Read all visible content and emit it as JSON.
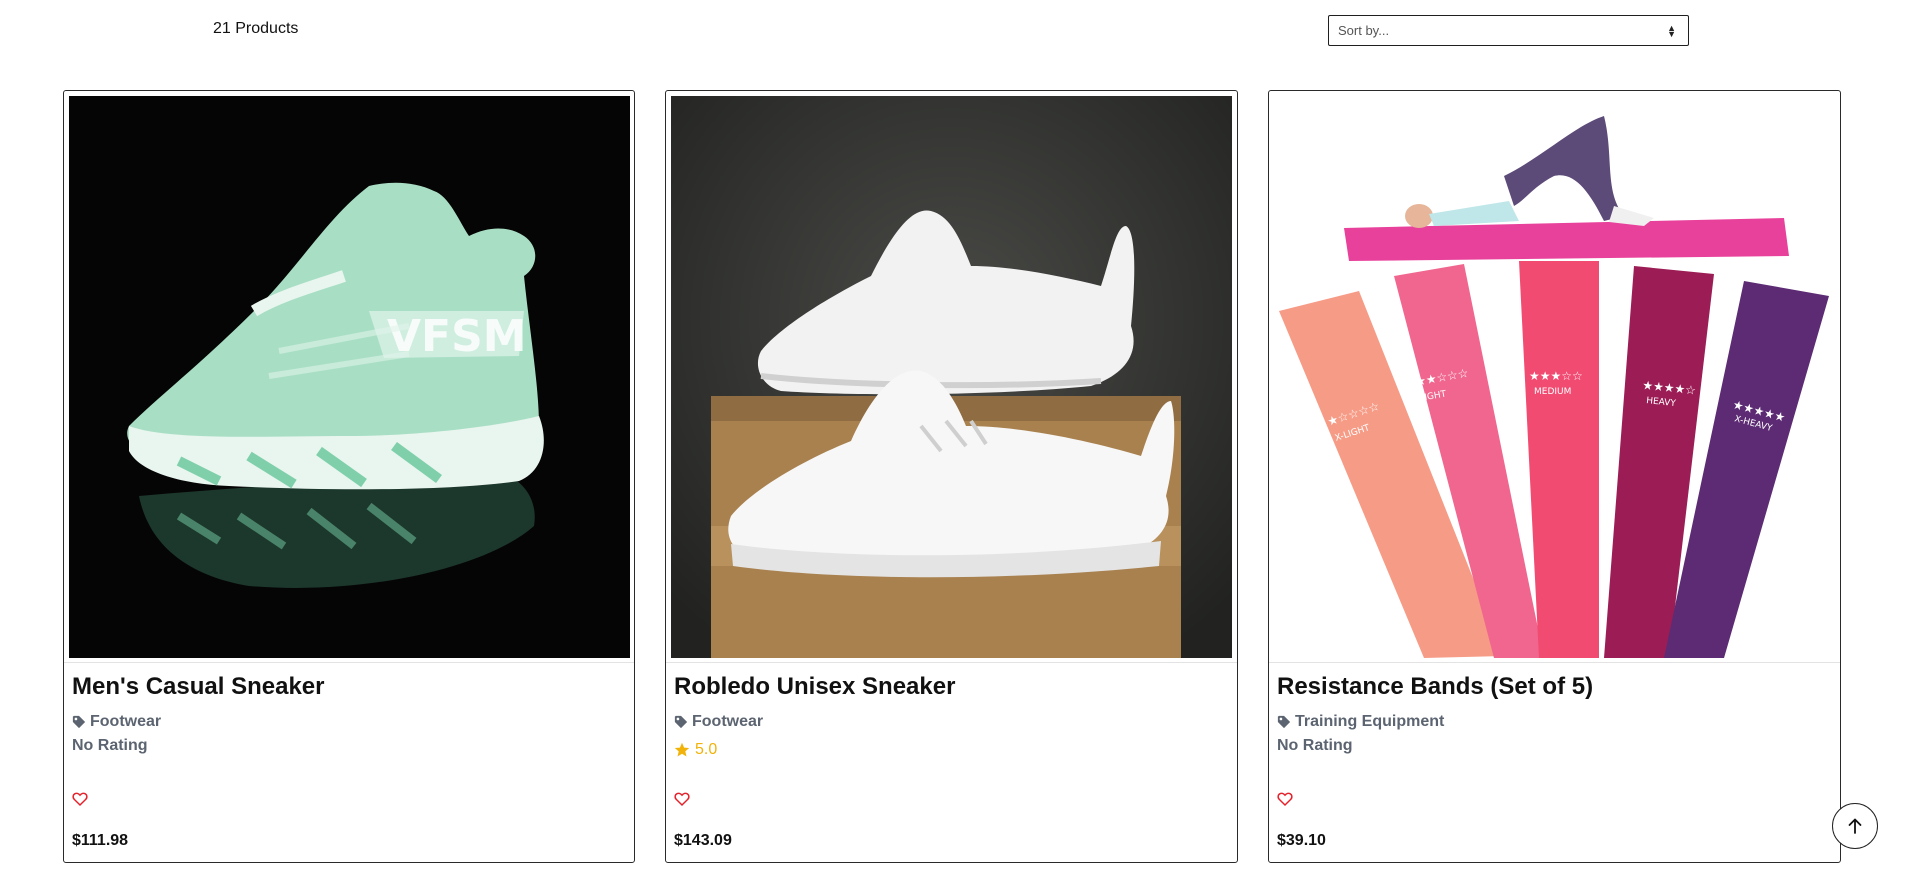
{
  "toolbar": {
    "product_count": "21 Products",
    "sort_placeholder": "Sort by..."
  },
  "products": [
    {
      "title": "Men's Casual Sneaker",
      "category": "Footwear",
      "rating": "No Rating",
      "price": "$111.98"
    },
    {
      "title": "Robledo Unisex Sneaker",
      "category": "Footwear",
      "rating": "5.0",
      "price": "$143.09"
    },
    {
      "title": "Resistance Bands (Set of 5)",
      "category": "Training Equipment",
      "rating": "No Rating",
      "price": "$39.10"
    }
  ],
  "band_labels": [
    "X-LIGHT",
    "LIGHT",
    "MEDIUM",
    "HEAVY",
    "X-HEAVY"
  ],
  "band_levels": [
    1,
    2,
    3,
    4,
    5
  ],
  "colors": {
    "heart": "#e5222b",
    "star": "#f1b20a",
    "category_text": "#5b6470",
    "band_colors": [
      "#f69b86",
      "#f0668f",
      "#f24b72",
      "#9c1d55",
      "#5c2b73"
    ],
    "mat": "#e8419b"
  },
  "icons": {
    "tag": "tag-icon",
    "star": "star-icon",
    "heart": "heart-outline-icon",
    "scroll_top": "arrow-up-icon",
    "sort": "sort-caret-icon"
  }
}
